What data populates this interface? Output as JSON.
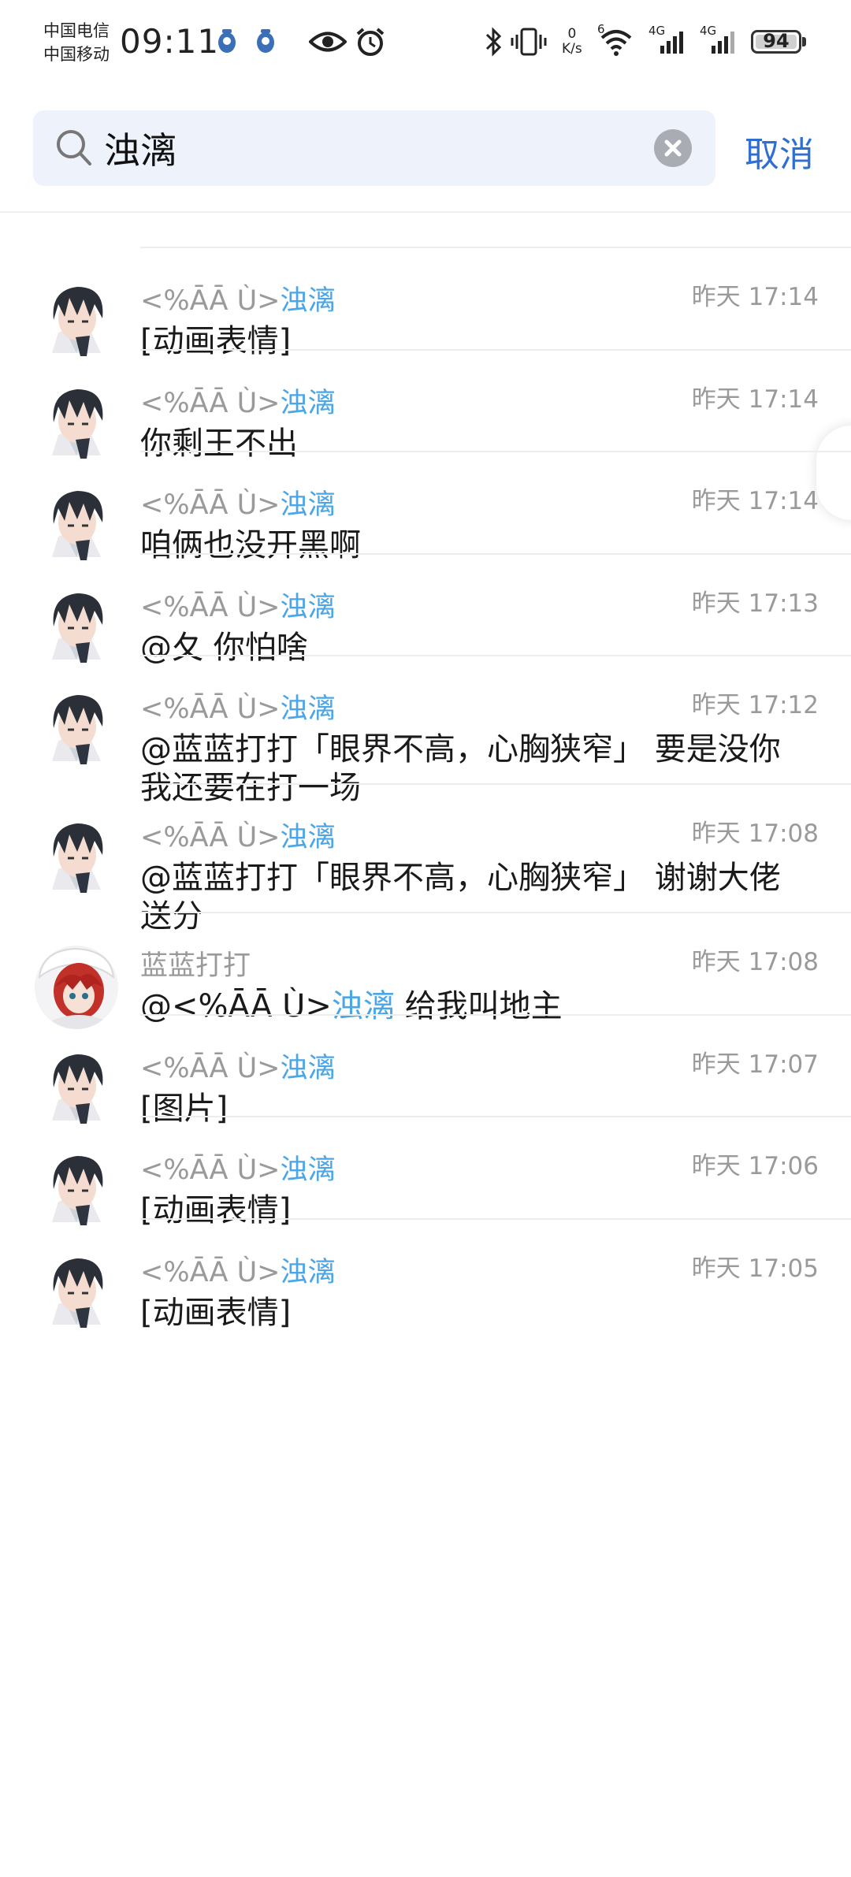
{
  "status_bar": {
    "carrier_1": "中国电信",
    "carrier_2": "中国移动",
    "time": "09:11",
    "net_speed_value": "0",
    "net_speed_unit": "K/s",
    "signal_1": "4G",
    "signal_2": "4G",
    "wifi_label": "6",
    "battery": "94"
  },
  "search": {
    "query": "浊漓",
    "cancel_label": "取消"
  },
  "results": [
    {
      "prefix": "<%ĀĀ Ù>",
      "highlight": "浊漓",
      "time": "昨天 17:14",
      "msg": [
        {
          "t": "[动画表情]"
        }
      ],
      "avatar": "dark-hair"
    },
    {
      "prefix": "<%ĀĀ Ù>",
      "highlight": "浊漓",
      "time": "昨天 17:14",
      "msg": [
        {
          "t": "你剩王不出"
        }
      ],
      "avatar": "dark-hair"
    },
    {
      "prefix": "<%ĀĀ Ù>",
      "highlight": "浊漓",
      "time": "昨天 17:14",
      "msg": [
        {
          "t": "咱俩也没开黑啊"
        }
      ],
      "avatar": "dark-hair"
    },
    {
      "prefix": "<%ĀĀ Ù>",
      "highlight": "浊漓",
      "time": "昨天 17:13",
      "msg": [
        {
          "t": "@夂 你怕啥"
        }
      ],
      "avatar": "dark-hair"
    },
    {
      "prefix": "<%ĀĀ Ù>",
      "highlight": "浊漓",
      "time": "昨天 17:12",
      "msg": [
        {
          "t": "@蓝蓝打打「眼界不高，心胸狭窄」 要是没你我还要在打一场"
        }
      ],
      "avatar": "dark-hair"
    },
    {
      "prefix": "<%ĀĀ Ù>",
      "highlight": "浊漓",
      "time": "昨天 17:08",
      "msg": [
        {
          "t": "@蓝蓝打打「眼界不高，心胸狭窄」 谢谢大佬送分"
        }
      ],
      "avatar": "dark-hair"
    },
    {
      "prefix": "蓝蓝打打",
      "highlight": "",
      "time": "昨天 17:08",
      "msg": [
        {
          "t": "@<%ĀĀ Ù>"
        },
        {
          "t": "浊漓",
          "hl": true
        },
        {
          "t": "  给我叫地主"
        }
      ],
      "avatar": "red-hair"
    },
    {
      "prefix": "<%ĀĀ Ù>",
      "highlight": "浊漓",
      "time": "昨天 17:07",
      "msg": [
        {
          "t": "[图片]"
        }
      ],
      "avatar": "dark-hair"
    },
    {
      "prefix": "<%ĀĀ Ù>",
      "highlight": "浊漓",
      "time": "昨天 17:06",
      "msg": [
        {
          "t": "[动画表情]"
        }
      ],
      "avatar": "dark-hair"
    },
    {
      "prefix": "<%ĀĀ Ù>",
      "highlight": "浊漓",
      "time": "昨天 17:05",
      "msg": [
        {
          "t": "[动画表情]"
        }
      ],
      "avatar": "dark-hair"
    }
  ]
}
